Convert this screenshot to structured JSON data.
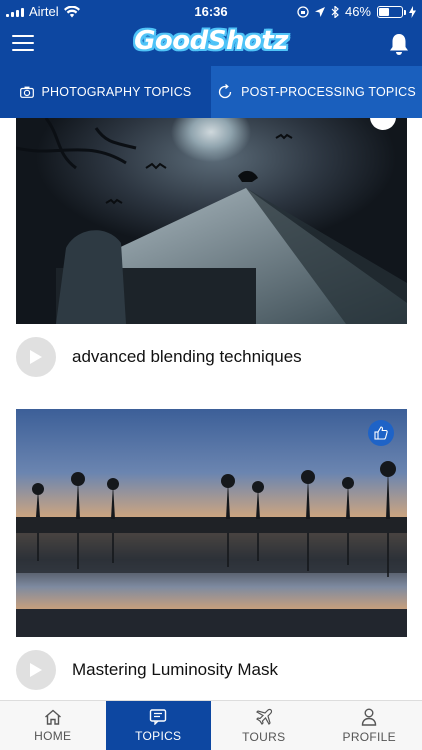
{
  "status": {
    "carrier": "Airtel",
    "time": "16:36",
    "battery": "46%",
    "battery_level": 0.46
  },
  "header": {
    "logo": "GoodShotz"
  },
  "tabs": [
    {
      "label": "PHOTOGRAPHY TOPICS",
      "icon": "camera-icon"
    },
    {
      "label": "POST-PROCESSING TOPICS",
      "icon": "refresh-icon"
    }
  ],
  "topics": [
    {
      "title": "advanced blending techniques"
    },
    {
      "title": "Mastering Luminosity Mask"
    }
  ],
  "bottom_nav": [
    {
      "label": "HOME",
      "icon": "home-icon"
    },
    {
      "label": "TOPICS",
      "icon": "topics-icon"
    },
    {
      "label": "TOURS",
      "icon": "plane-icon"
    },
    {
      "label": "PROFILE",
      "icon": "person-icon"
    }
  ],
  "colors": {
    "primary": "#0d47a1",
    "accent": "#1e63c7"
  }
}
